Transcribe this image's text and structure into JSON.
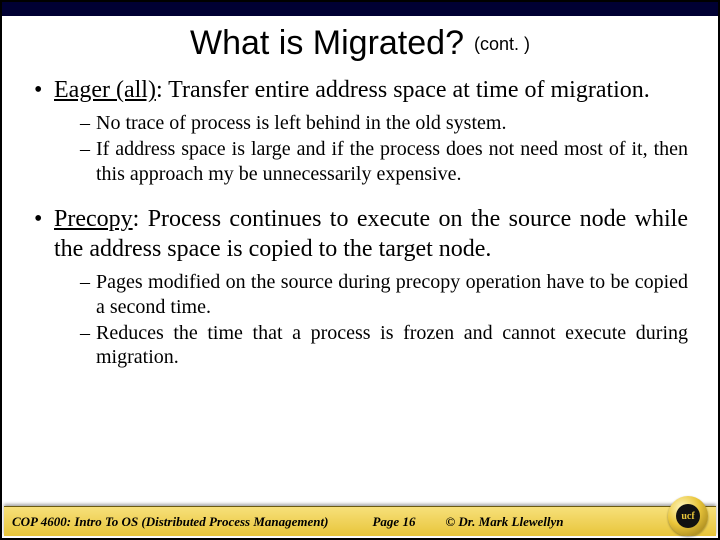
{
  "title": "What is Migrated?",
  "title_cont": "(cont. )",
  "bullets": [
    {
      "lead": "Eager (all)",
      "rest": ": Transfer entire address space at time of migration.",
      "subs": [
        "No trace of process is left behind in the old system.",
        "If address space is large and if the process does not need most of it, then this approach my be unnecessarily expensive."
      ]
    },
    {
      "lead": "Precopy",
      "rest": ": Process continues to execute on the source node while the address space is copied to the target node.",
      "subs": [
        "Pages modified on the source during precopy operation have to be copied a second time.",
        "Reduces the time that a process is frozen and cannot execute during migration."
      ]
    }
  ],
  "footer": {
    "course": "COP 4600: Intro To OS  (Distributed Process Management)",
    "page": "Page 16",
    "copyright": "© Dr. Mark Llewellyn"
  },
  "logo_text": "ucf"
}
